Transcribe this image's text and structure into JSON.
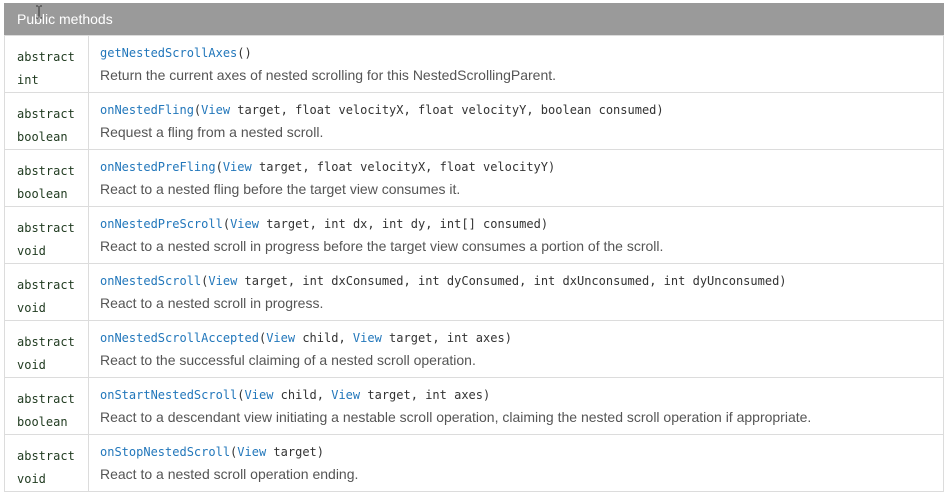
{
  "header": {
    "title": "Public methods"
  },
  "methods": [
    {
      "modifier": "abstract",
      "return_type": "int",
      "name": "getNestedScrollAxes",
      "params": [],
      "description": "Return the current axes of nested scrolling for this NestedScrollingParent."
    },
    {
      "modifier": "abstract",
      "return_type": "boolean",
      "name": "onNestedFling",
      "params": [
        {
          "type": "View",
          "type_link": true,
          "name": "target"
        },
        {
          "type": "float",
          "type_link": false,
          "name": "velocityX"
        },
        {
          "type": "float",
          "type_link": false,
          "name": "velocityY"
        },
        {
          "type": "boolean",
          "type_link": false,
          "name": "consumed"
        }
      ],
      "description": "Request a fling from a nested scroll."
    },
    {
      "modifier": "abstract",
      "return_type": "boolean",
      "name": "onNestedPreFling",
      "params": [
        {
          "type": "View",
          "type_link": true,
          "name": "target"
        },
        {
          "type": "float",
          "type_link": false,
          "name": "velocityX"
        },
        {
          "type": "float",
          "type_link": false,
          "name": "velocityY"
        }
      ],
      "description": "React to a nested fling before the target view consumes it."
    },
    {
      "modifier": "abstract",
      "return_type": "void",
      "name": "onNestedPreScroll",
      "params": [
        {
          "type": "View",
          "type_link": true,
          "name": "target"
        },
        {
          "type": "int",
          "type_link": false,
          "name": "dx"
        },
        {
          "type": "int",
          "type_link": false,
          "name": "dy"
        },
        {
          "type": "int[]",
          "type_link": false,
          "name": "consumed"
        }
      ],
      "description": "React to a nested scroll in progress before the target view consumes a portion of the scroll."
    },
    {
      "modifier": "abstract",
      "return_type": "void",
      "name": "onNestedScroll",
      "params": [
        {
          "type": "View",
          "type_link": true,
          "name": "target"
        },
        {
          "type": "int",
          "type_link": false,
          "name": "dxConsumed"
        },
        {
          "type": "int",
          "type_link": false,
          "name": "dyConsumed"
        },
        {
          "type": "int",
          "type_link": false,
          "name": "dxUnconsumed"
        },
        {
          "type": "int",
          "type_link": false,
          "name": "dyUnconsumed"
        }
      ],
      "description": "React to a nested scroll in progress."
    },
    {
      "modifier": "abstract",
      "return_type": "void",
      "name": "onNestedScrollAccepted",
      "params": [
        {
          "type": "View",
          "type_link": true,
          "name": "child"
        },
        {
          "type": "View",
          "type_link": true,
          "name": "target"
        },
        {
          "type": "int",
          "type_link": false,
          "name": "axes"
        }
      ],
      "description": "React to the successful claiming of a nested scroll operation."
    },
    {
      "modifier": "abstract",
      "return_type": "boolean",
      "name": "onStartNestedScroll",
      "params": [
        {
          "type": "View",
          "type_link": true,
          "name": "child"
        },
        {
          "type": "View",
          "type_link": true,
          "name": "target"
        },
        {
          "type": "int",
          "type_link": false,
          "name": "axes"
        }
      ],
      "description": "React to a descendant view initiating a nestable scroll operation, claiming the nested scroll operation if appropriate."
    },
    {
      "modifier": "abstract",
      "return_type": "void",
      "name": "onStopNestedScroll",
      "params": [
        {
          "type": "View",
          "type_link": true,
          "name": "target"
        }
      ],
      "description": "React to a nested scroll operation ending."
    }
  ]
}
